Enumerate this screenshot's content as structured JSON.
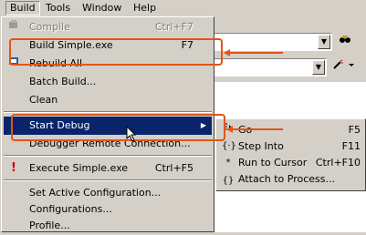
{
  "menubar": {
    "items": [
      {
        "label": "Build"
      },
      {
        "label": "Tools"
      },
      {
        "label": "Window"
      },
      {
        "label": "Help"
      }
    ]
  },
  "build_menu": {
    "compile": {
      "label": "Compile",
      "shortcut": "Ctrl+F7"
    },
    "build": {
      "label": "Build Simple.exe",
      "shortcut": "F7"
    },
    "rebuild_all": {
      "label": "Rebuild All"
    },
    "batch_build": {
      "label": "Batch Build..."
    },
    "clean": {
      "label": "Clean"
    },
    "start_debug": {
      "label": "Start Debug"
    },
    "debugger_remote": {
      "label": "Debugger Remote Connection..."
    },
    "execute": {
      "label": "Execute Simple.exe",
      "shortcut": "Ctrl+F5"
    },
    "set_active_config": {
      "label": "Set Active Configuration..."
    },
    "configurations": {
      "label": "Configurations..."
    },
    "profile": {
      "label": "Profile..."
    }
  },
  "debug_submenu": {
    "go": {
      "label": "Go",
      "shortcut": "F5"
    },
    "step_into": {
      "label": "Step Into",
      "shortcut": "F11"
    },
    "run_to_cursor": {
      "label": "Run to Cursor",
      "shortcut": "Ctrl+F10"
    },
    "attach": {
      "label": "Attach to Process..."
    }
  },
  "colors": {
    "highlight": "#e0561a",
    "selection": "#0a246a"
  },
  "icons": [
    "compile-icon",
    "rebuild-icon",
    "execute-icon",
    "go-icon",
    "step-into-icon",
    "run-to-cursor-icon",
    "find-icon",
    "wizard-icon",
    "submenu-arrow-icon",
    "mouse-cursor-icon"
  ]
}
